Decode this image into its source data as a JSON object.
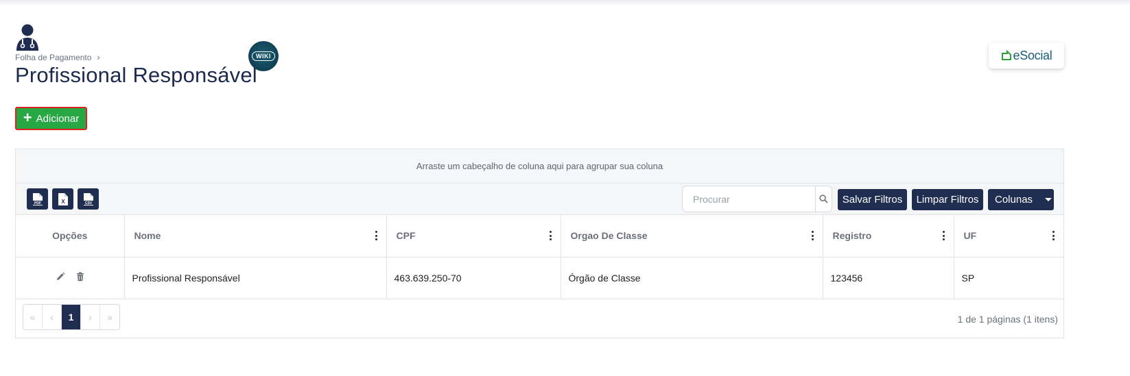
{
  "breadcrumb": {
    "parent": "Folha de Pagamento"
  },
  "page": {
    "title": "Profissional Responsável",
    "wiki_label": "WIKI"
  },
  "brand": {
    "esocial_label": "eSocial"
  },
  "actions": {
    "add_label": "Adicionar"
  },
  "grid": {
    "group_panel_text": "Arraste um cabeçalho de coluna aqui para agrupar sua coluna",
    "export": {
      "pdf": "PDF",
      "xls": "X",
      "csv": "CSV"
    },
    "search_placeholder": "Procurar",
    "save_filters_label": "Salvar Filtros",
    "clear_filters_label": "Limpar Filtros",
    "columns_label": "Colunas",
    "headers": [
      "Opções",
      "Nome",
      "CPF",
      "Orgao De Classe",
      "Registro",
      "UF"
    ],
    "rows": [
      {
        "nome": "Profissional Responsável",
        "cpf": "463.639.250-70",
        "orgao": "Órgão de Classe",
        "registro": "123456",
        "uf": "SP"
      }
    ],
    "pager": {
      "first": "«",
      "prev": "‹",
      "current": "1",
      "next": "›",
      "last": "»"
    },
    "pager_info": "1 de 1 páginas (1 itens)"
  },
  "colors": {
    "primary": "#1f2d51",
    "add_button": "#28a745",
    "highlight_border": "#e02020",
    "esocial_green": "#2e9e3a",
    "esocial_blue": "#1b5c7a"
  },
  "icons": [
    "profile-icon",
    "chevron-right-icon",
    "plus-icon",
    "pdf-icon",
    "xls-icon",
    "csv-icon",
    "search-icon",
    "caret-down-icon",
    "kebab-menu-icon",
    "pencil-icon",
    "trash-icon"
  ]
}
